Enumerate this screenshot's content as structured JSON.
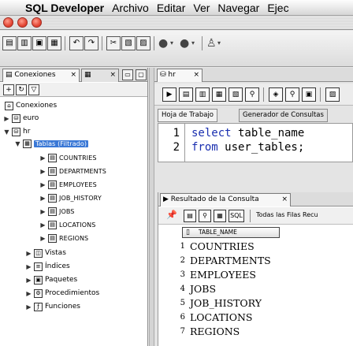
{
  "menubar": {
    "app_name": "SQL Developer",
    "items": [
      "Archivo",
      "Editar",
      "Ver",
      "Navegar",
      "Ejec"
    ]
  },
  "connections_panel": {
    "tab_label": "Conexiones",
    "tree_root": "Conexiones",
    "connections": [
      {
        "label": "euro",
        "expanded": false
      },
      {
        "label": "hr",
        "expanded": true
      }
    ],
    "tables_node": "Tablas (Filtrado)",
    "tables": [
      "COUNTRIES",
      "DEPARTMENTS",
      "EMPLOYEES",
      "JOB_HISTORY",
      "JOBS",
      "LOCATIONS",
      "REGIONS"
    ],
    "other_nodes": [
      "Vistas",
      "Índices",
      "Paquetes",
      "Procedimientos",
      "Funciones"
    ]
  },
  "editor": {
    "tab_label": "hr",
    "sub_tabs": [
      "Hoja de Trabajo",
      "Generador de Consultas"
    ],
    "lines": [
      {
        "num": "1",
        "keyword": "select",
        "rest": " table_name"
      },
      {
        "num": "2",
        "keyword": "from",
        "rest": " user_tables;"
      }
    ]
  },
  "results": {
    "tab_label": "Resultado de la Consulta",
    "sql_label": "SQL",
    "fetch_label": "Todas las Filas Recu",
    "column_header": "TABLE_NAME",
    "rows": [
      {
        "num": "1",
        "value": "COUNTRIES"
      },
      {
        "num": "2",
        "value": "DEPARTMENTS"
      },
      {
        "num": "3",
        "value": "EMPLOYEES"
      },
      {
        "num": "4",
        "value": "JOBS"
      },
      {
        "num": "5",
        "value": "JOB_HISTORY"
      },
      {
        "num": "6",
        "value": "LOCATIONS"
      },
      {
        "num": "7",
        "value": "REGIONS"
      }
    ]
  },
  "colors": {
    "selection": "#3a78d6",
    "keyword": "#1a2fb0",
    "close_button": "#e1412f"
  }
}
